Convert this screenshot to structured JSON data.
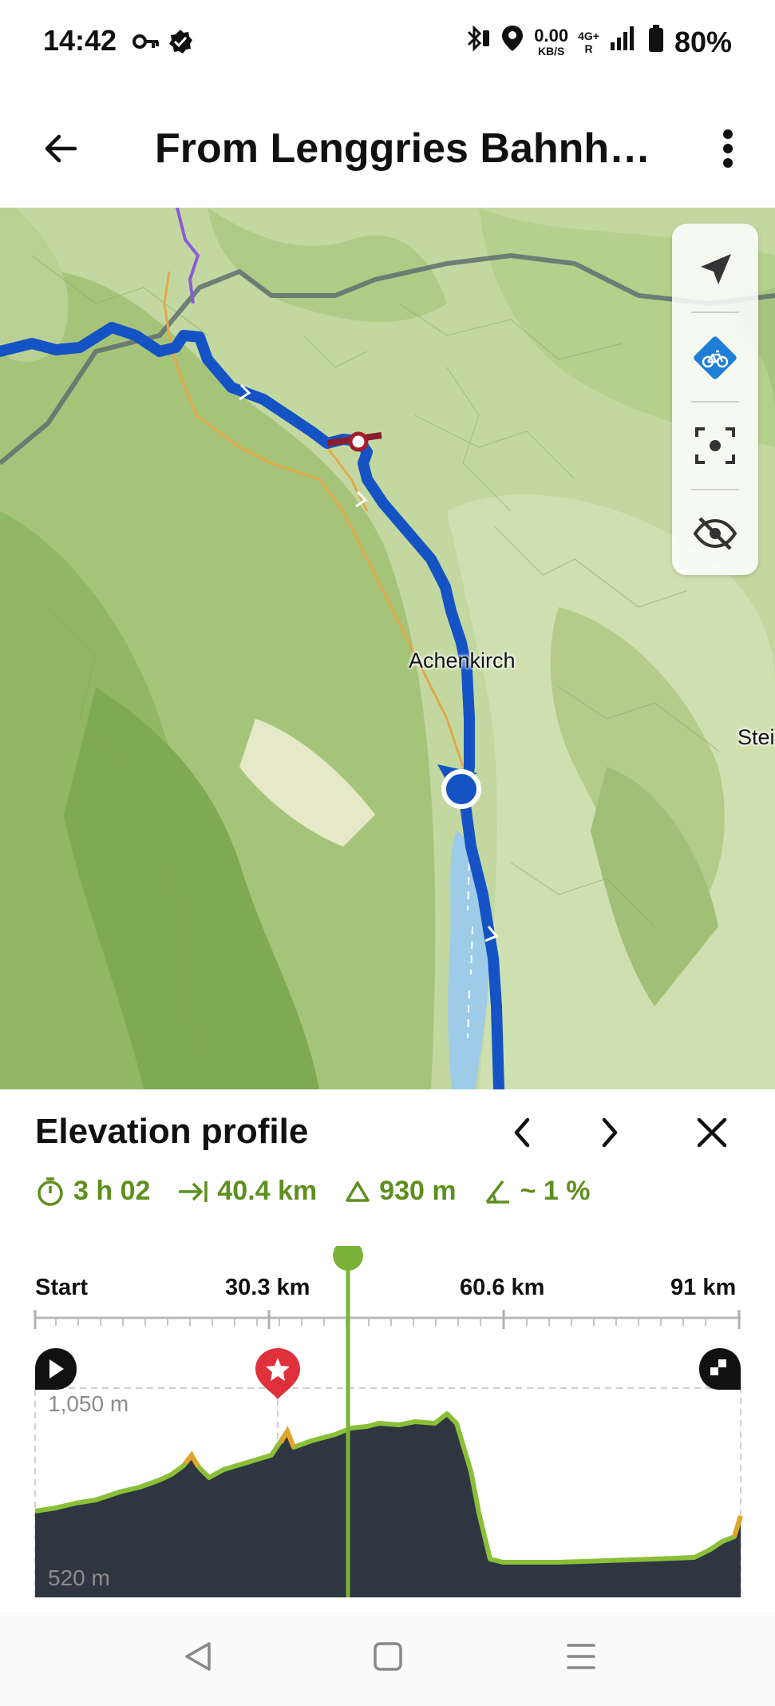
{
  "status_bar": {
    "time": "14:42",
    "network_speed_value": "0.00",
    "network_speed_unit": "KB/S",
    "network_type": "4G+",
    "roaming": "R",
    "battery": "80%"
  },
  "app_bar": {
    "title": "From Lenggries Bahnhof…"
  },
  "map": {
    "labels": {
      "town_1": "Achenkirch",
      "town_2": "Stei"
    },
    "route_color": "#1553c4",
    "water_color": "#9dcbe8"
  },
  "sheet": {
    "title": "Elevation profile",
    "stats": {
      "duration": "3 h 02",
      "distance": "40.4 km",
      "ascent": "930 m",
      "gradient": "~ 1 %"
    },
    "axis": {
      "start": "Start",
      "mark_1": "30.3 km",
      "mark_2": "60.6 km",
      "end": "91 km"
    },
    "elevation": {
      "max_label": "1,050 m",
      "min_label": "520 m"
    },
    "accent_color": "#7bb33a",
    "profile_fill": "#2e3642"
  }
}
